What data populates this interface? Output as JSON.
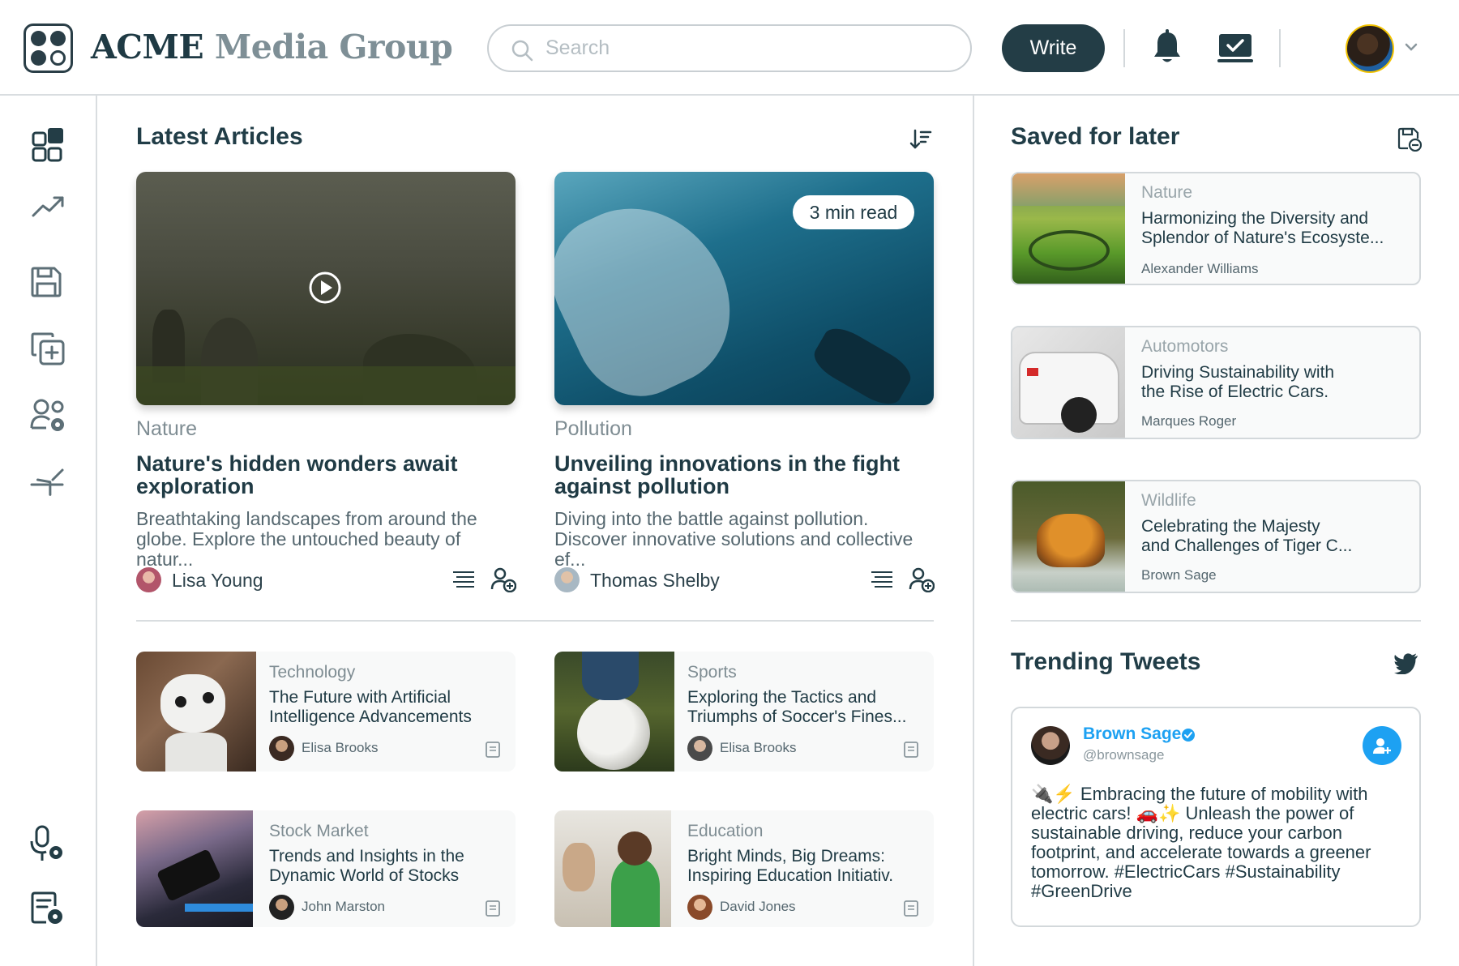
{
  "header": {
    "brand_part1": "ACME",
    "brand_part2": "Media Group",
    "search_placeholder": "Search",
    "write_label": "Write",
    "icons": [
      "logo-icon",
      "search-icon",
      "bell-icon",
      "inbox-check-icon",
      "chevron-down-icon"
    ]
  },
  "sidebar": {
    "items": [
      "dashboard-icon",
      "trending-icon",
      "save-icon",
      "add-copy-icon",
      "user-settings-icon",
      "collapse-icon",
      "mic-settings-icon",
      "document-settings-icon"
    ]
  },
  "latest": {
    "title": "Latest Articles",
    "featured": [
      {
        "category": "Nature",
        "title_line1": "Nature's hidden wonders await",
        "title_line2": "exploration",
        "desc_line1": "Breathtaking landscapes from around the",
        "desc_line2": "globe. Explore the untouched beauty of natur...",
        "author": "Lisa Young"
      },
      {
        "category": "Pollution",
        "badge": "3 min read",
        "title_line1": "Unveiling innovations in the fight",
        "title_line2": "against pollution",
        "desc_line1": "Diving into the battle against pollution.",
        "desc_line2": "Discover innovative solutions and collective ef...",
        "author": "Thomas Shelby"
      }
    ],
    "small": [
      {
        "category": "Technology",
        "title_line1": "The Future with Artificial",
        "title_line2": "Intelligence Advancements",
        "author": "Elisa Brooks"
      },
      {
        "category": "Sports",
        "title_line1": "Exploring the Tactics and",
        "title_line2": "Triumphs of Soccer's Fines...",
        "author": "Elisa Brooks"
      },
      {
        "category": "Stock Market",
        "title_line1": "Trends and Insights in the",
        "title_line2": "Dynamic World of Stocks",
        "author": "John Marston"
      },
      {
        "category": "Education",
        "title_line1": "Bright Minds, Big Dreams:",
        "title_line2": "Inspiring Education Initiativ.",
        "author": "David Jones"
      }
    ]
  },
  "saved": {
    "title": "Saved for later",
    "items": [
      {
        "category": "Nature",
        "title_line1": "Harmonizing the Diversity and",
        "title_line2": "Splendor of Nature's Ecosyste...",
        "author": "Alexander Williams"
      },
      {
        "category": "Automotors",
        "title_line1": "Driving Sustainability with",
        "title_line2": "the Rise of Electric Cars.",
        "author": "Marques Roger"
      },
      {
        "category": "Wildlife",
        "title_line1": "Celebrating the Majesty",
        "title_line2": "and Challenges of Tiger C...",
        "author": "Brown Sage"
      }
    ]
  },
  "tweets": {
    "title": "Trending Tweets",
    "name": "Brown Sage",
    "handle": "@brownsage",
    "text": "🔌⚡ Embracing the future of mobility with electric cars! 🚗✨ Unleash the power of sustainable driving, reduce your carbon footprint, and accelerate towards a greener tomorrow. #ElectricCars #Sustainability #GreenDrive"
  },
  "colors": {
    "primary_dark": "#233d46",
    "accent_blue": "#1da1f2",
    "muted_text": "#7f8d93",
    "border": "#d9dde0"
  }
}
